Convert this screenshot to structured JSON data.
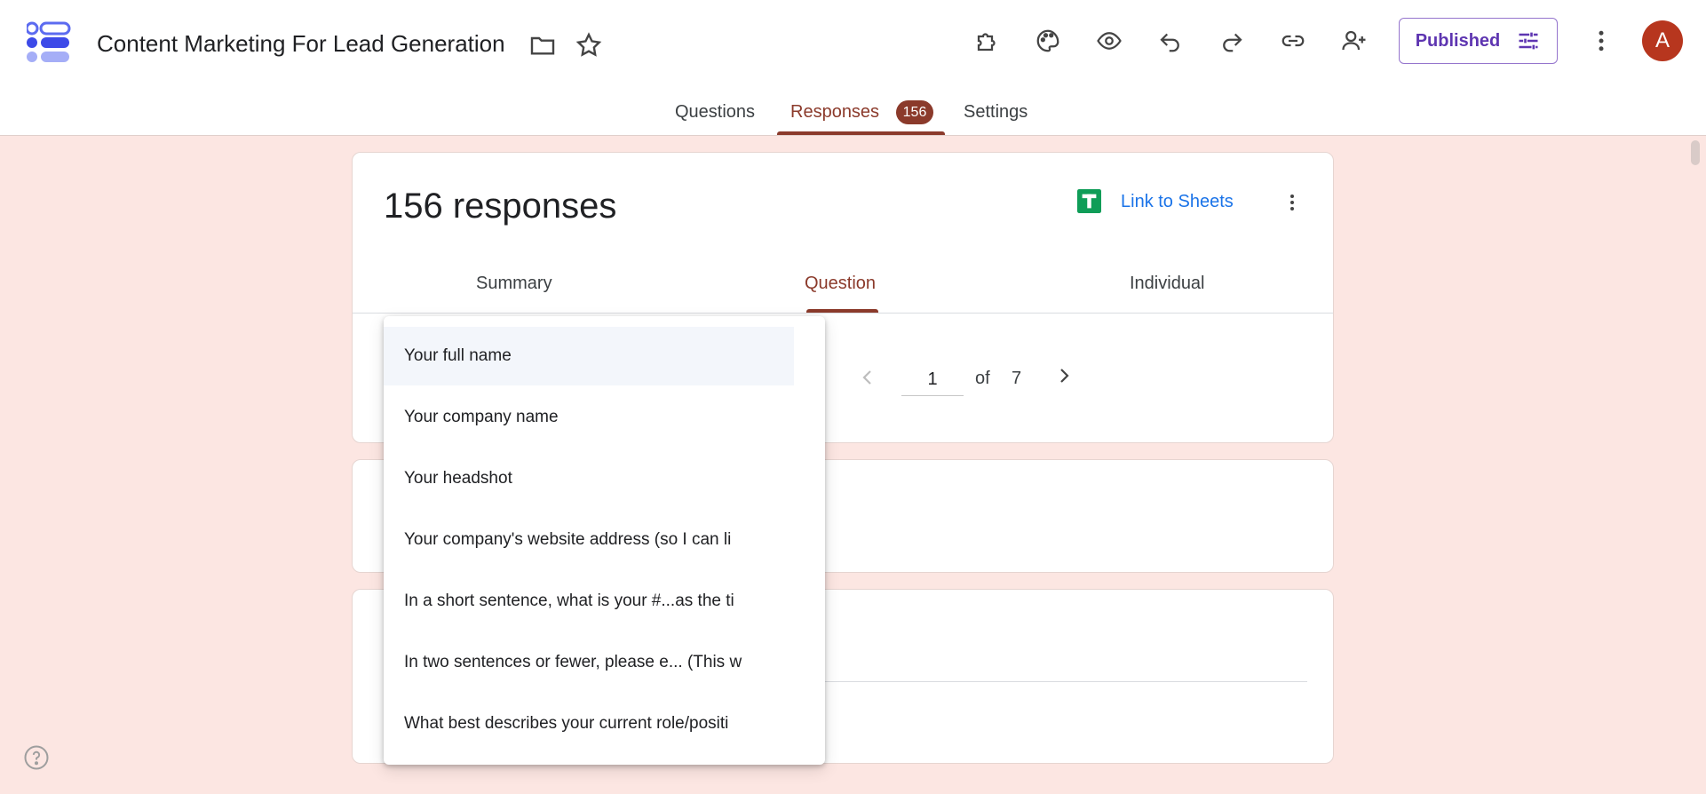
{
  "header": {
    "title": "Content Marketing For Lead Generation",
    "publish_label": "Published",
    "avatar_letter": "A"
  },
  "tabs": [
    {
      "label": "Questions"
    },
    {
      "label": "Responses",
      "badge": "156"
    },
    {
      "label": "Settings"
    }
  ],
  "responses": {
    "count_label": "156 responses",
    "sheets_link": "Link to Sheets",
    "subtabs": [
      "Summary",
      "Question",
      "Individual"
    ],
    "pager": {
      "current": "1",
      "of_label": "of",
      "total": "7"
    }
  },
  "question_dropdown": {
    "items": [
      "Your full name",
      "Your company name",
      "Your headshot",
      "Your company's website address (so I can li",
      "In a short sentence, what is your #...as the ti",
      "In two sentences or fewer, please e... (This w",
      "What best describes your current role/positi"
    ]
  },
  "colors": {
    "accent": "#8b3a2b",
    "background": "#fce6e2",
    "publish": "#5e35b1",
    "link": "#1a73e8",
    "sheets_green": "#0f9d58",
    "avatar": "#b7361e"
  },
  "icons": {
    "toolbar": [
      "puzzle-icon",
      "palette-icon",
      "eye-icon",
      "undo-icon",
      "redo-icon",
      "link-icon",
      "add-person-icon",
      "more-vert-icon"
    ]
  }
}
